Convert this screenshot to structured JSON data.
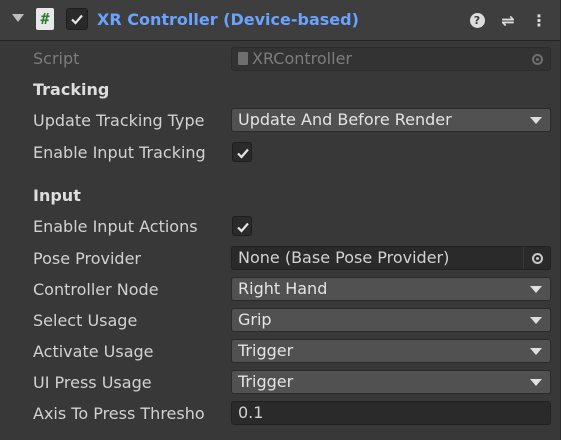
{
  "component": {
    "title": "XR Controller (Device-based)",
    "script_icon_glyph": "#",
    "header_icons": [
      "help-icon",
      "presets-icon",
      "menu-icon"
    ],
    "help_glyph": "?",
    "presets_glyph": "⇌",
    "menu_glyph": "⋮",
    "title_color": "#6aa3ff"
  },
  "script": {
    "label": "Script",
    "value": "XRController"
  },
  "tracking": {
    "header": "Tracking",
    "update_tracking_type_label": "Update Tracking Type",
    "update_tracking_type_value": "Update And Before Render",
    "enable_input_tracking_label": "Enable Input Tracking",
    "enable_input_tracking_checked": true
  },
  "input": {
    "header": "Input",
    "enable_input_actions_label": "Enable Input Actions",
    "enable_input_actions_checked": true,
    "pose_provider_label": "Pose Provider",
    "pose_provider_value": "None (Base Pose Provider)",
    "controller_node_label": "Controller Node",
    "controller_node_value": "Right Hand",
    "select_usage_label": "Select Usage",
    "select_usage_value": "Grip",
    "activate_usage_label": "Activate Usage",
    "activate_usage_value": "Trigger",
    "ui_press_usage_label": "UI Press Usage",
    "ui_press_usage_value": "Trigger",
    "axis_to_press_threshold_label": "Axis To Press Thresho",
    "axis_to_press_threshold_value": "0.1"
  }
}
